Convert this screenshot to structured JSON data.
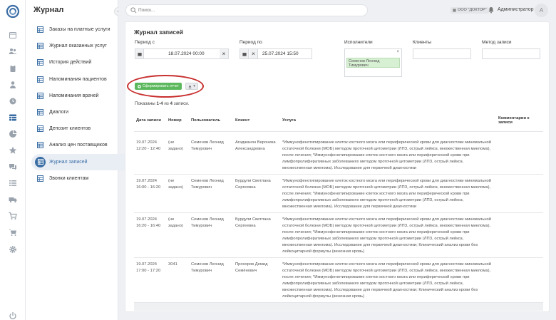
{
  "sidebar": {
    "title": "Журнал",
    "items": [
      {
        "label": "Заказы на платные услуги"
      },
      {
        "label": "Журнал оказанных услуг"
      },
      {
        "label": "История действий"
      },
      {
        "label": "Напоминания пациентов"
      },
      {
        "label": "Напоминания врачей"
      },
      {
        "label": "Диалоги"
      },
      {
        "label": "Депозит клиентов"
      },
      {
        "label": "Анализ цен поставщиков"
      },
      {
        "label": "Журнал записей"
      },
      {
        "label": "Звонки клиентам"
      }
    ],
    "active_index": 8
  },
  "topbar": {
    "search_placeholder": "Поиск...",
    "org": "ООО \"ДОКТОР\"",
    "user_name": "Администратор",
    "avatar_letter": "А"
  },
  "page": {
    "title": "Журнал записей",
    "filters": {
      "period_from_label": "Период с",
      "period_from_value": "18.07.2024 00:00",
      "period_to_label": "Период по",
      "period_to_value": "25.07.2024 15:50",
      "executors_label": "Исполнители",
      "executor_chip": "Семенов Леонид Тимурович",
      "clients_label": "Клиенты",
      "method_label": "Метод записи"
    },
    "report_button": "Сформировать отчет",
    "shown_prefix": "Показаны",
    "shown_range": "1-4",
    "shown_mid": "из",
    "shown_total": "4",
    "shown_suffix": "записи."
  },
  "table": {
    "columns": [
      "Дата записи",
      "Номер",
      "Пользователь",
      "Клиент",
      "Услуга",
      "Комментарии к записи"
    ],
    "rows": [
      {
        "date": "19.07.2024 12:20 - 12:40",
        "number": "(не задано)",
        "user": "Семенов Леонид Тимурович",
        "client": "Агаджанян Вероника Александровна",
        "service": "*Иммунофенотипирование клеток костного мозга или периферической крови для диагностики минимальной остаточной болезни (МОБ) методом проточной цитометрии (ЛПЗ, острый лейкоз, множественная миелома), после лечения; *Иммунофенотипирование клеток костного мозга или периферической крови при лимфопролиферативных заболеваниях методом проточной цитометрии (ЛПЗ, острый лейкоз, множественная миелома). Исследование для первичной диагностики",
        "comment": ""
      },
      {
        "date": "19.07.2024 16:00 - 16:20",
        "number": "(не задано)",
        "user": "Семенов Леонид Тимурович",
        "client": "Бурдули Светлана Сергеевна",
        "service": "*Иммунофенотипирование клеток костного мозга или периферической крови для диагностики минимальной остаточной болезни (МОБ) методом проточной цитометрии (ЛПЗ, острый лейкоз, множественная миелома), после лечения; *Иммунофенотипирование клеток костного мозга или периферической крови при лимфопролиферативных заболеваниях методом проточной цитометрии (ЛПЗ, острый лейкоз, множественная миелома). Исследование для первичной диагностики",
        "comment": ""
      },
      {
        "date": "19.07.2024 16:20 - 16:40",
        "number": "(не задано)",
        "user": "Семенов Леонид Тимурович",
        "client": "Бурдули Светлана Сергеевна",
        "service": "*Иммунофенотипирование клеток костного мозга или периферической крови для диагностики минимальной остаточной болезни (МОБ) методом проточной цитометрии (ЛПЗ, острый лейкоз, множественная миелома), после лечения; *Иммунофенотипирование клеток костного мозга или периферической крови при лимфопролиферативных заболеваниях методом проточной цитометрии (ЛПЗ, острый лейкоз, множественная миелома). Исследование для первичной диагностики; Клинический анализ крови без лейкоцитарной формулы (венозная кровь)",
        "comment": ""
      },
      {
        "date": "19.07.2024 17:00 - 17:20",
        "number": "3041",
        "user": "Семенов Леонид Тимурович",
        "client": "Прохоров Демид Семёнович",
        "service": "*Иммунофенотипирование клеток костного мозга или периферической крови для диагностики минимальной остаточной болезни (МОБ) методом проточной цитометрии (ЛПЗ, острый лейкоз, множественная миелома), после лечения; *Иммунофенотипирование клеток костного мозга или периферической крови при лимфопролиферативных заболеваниях методом проточной цитометрии (ЛПЗ, острый лейкоз, множественная миелома). Исследование для первичной диагностики; Клинический анализ крови без лейкоцитарной формулы (венозная кровь)",
        "comment": ""
      }
    ]
  },
  "colors": {
    "accent": "#3b6ea5",
    "report_button": "#5cb85c",
    "highlight_oval": "#c8302f",
    "executor_chip": "#d7efd3"
  }
}
